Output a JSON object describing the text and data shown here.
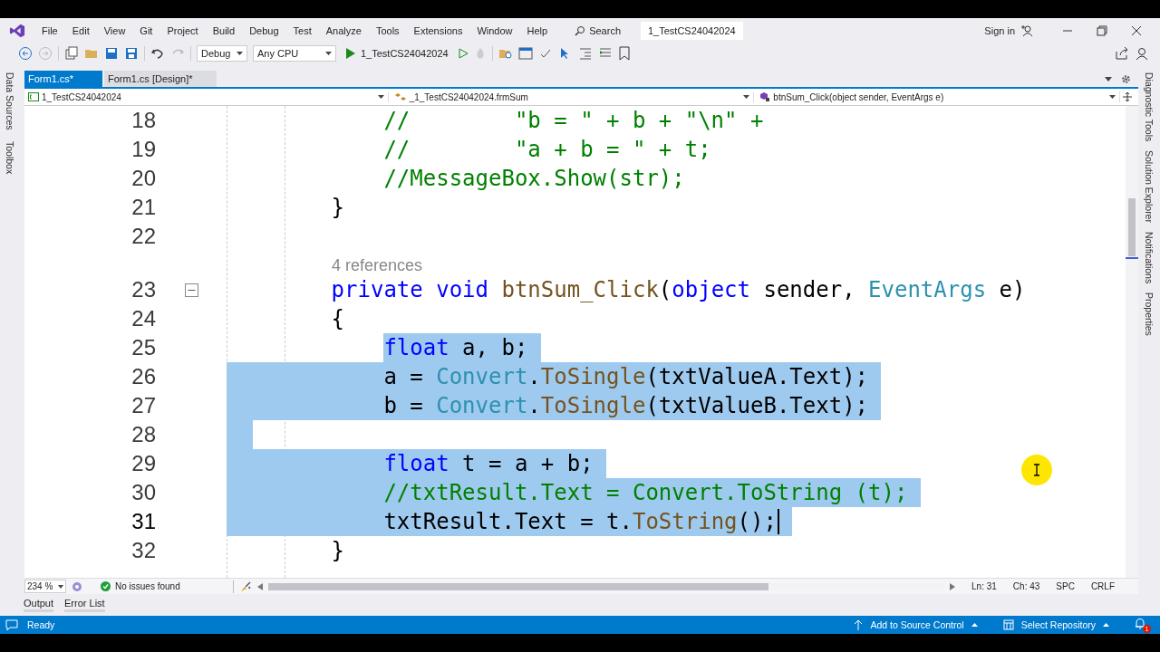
{
  "menu_bar": {
    "items": [
      "File",
      "Edit",
      "View",
      "Git",
      "Project",
      "Build",
      "Debug",
      "Test",
      "Analyze",
      "Tools",
      "Extensions",
      "Window",
      "Help"
    ],
    "search": "Search",
    "solution_name": "1_TestCS24042024",
    "sign_in": "Sign in"
  },
  "toolbar": {
    "configuration": "Debug",
    "platform": "Any CPU",
    "start_target": "1_TestCS24042024"
  },
  "left_panel_tabs": [
    "Data Sources",
    "Toolbox"
  ],
  "right_panel_tabs": [
    "Diagnostic Tools",
    "Solution Explorer",
    "Notifications",
    "Properties"
  ],
  "document_tabs": [
    {
      "label": "Form1.cs*",
      "selected": true
    },
    {
      "label": "Form1.cs [Design]*",
      "selected": false
    }
  ],
  "navigation_bar": {
    "project": "1_TestCS24042024",
    "class": "_1_TestCS24042024.frmSum",
    "member": "btnSum_Click(object sender, EventArgs e)"
  },
  "editor": {
    "lines": [
      {
        "kind": "code",
        "number": "18",
        "selected": false,
        "tokens": [
          {
            "kind": "comment",
            "text": "            //        \"b = \" + b + \"\\n\" +"
          }
        ]
      },
      {
        "kind": "code",
        "number": "19",
        "selected": false,
        "tokens": [
          {
            "kind": "comment",
            "text": "            //        \"a + b = \" + t;"
          }
        ]
      },
      {
        "kind": "code",
        "number": "20",
        "selected": false,
        "tokens": [
          {
            "kind": "comment",
            "text": "            //MessageBox.Show(str);"
          }
        ]
      },
      {
        "kind": "code",
        "number": "21",
        "selected": false,
        "tokens": [
          {
            "kind": "plain",
            "text": "        }"
          }
        ]
      },
      {
        "kind": "code",
        "number": "22",
        "selected": false
      },
      {
        "kind": "codelens",
        "text": "4 references"
      },
      {
        "kind": "code",
        "number": "23",
        "selected": false,
        "expanded": true,
        "tokens": [
          {
            "kind": "keyword",
            "text": "        private void "
          },
          {
            "kind": "method",
            "text": "btnSum_Click"
          },
          {
            "kind": "plain",
            "text": "("
          },
          {
            "kind": "keyword",
            "text": "object"
          },
          {
            "kind": "plain",
            "text": " sender, "
          },
          {
            "kind": "type",
            "text": "EventArgs"
          },
          {
            "kind": "plain",
            "text": " e)"
          }
        ]
      },
      {
        "kind": "code",
        "number": "24",
        "selected": false,
        "tokens": [
          {
            "kind": "plain",
            "text": "        {"
          }
        ]
      },
      {
        "kind": "code",
        "number": "25",
        "selected": true,
        "from_code": true,
        "tokens": [
          {
            "kind": "keyword",
            "text": "            float"
          },
          {
            "kind": "plain",
            "text": " a, b;"
          }
        ]
      },
      {
        "kind": "code",
        "number": "26",
        "selected": true,
        "tokens": [
          {
            "kind": "plain",
            "text": "            a = "
          },
          {
            "kind": "type",
            "text": "Convert"
          },
          {
            "kind": "plain",
            "text": "."
          },
          {
            "kind": "method",
            "text": "ToSingle"
          },
          {
            "kind": "plain",
            "text": "(txtValueA.Text);"
          }
        ]
      },
      {
        "kind": "code",
        "number": "27",
        "selected": true,
        "tokens": [
          {
            "kind": "plain",
            "text": "            b = "
          },
          {
            "kind": "type",
            "text": "Convert"
          },
          {
            "kind": "plain",
            "text": "."
          },
          {
            "kind": "method",
            "text": "ToSingle"
          },
          {
            "kind": "plain",
            "text": "(txtValueB.Text);"
          }
        ]
      },
      {
        "kind": "code",
        "number": "28",
        "selected": true
      },
      {
        "kind": "code",
        "number": "29",
        "selected": true,
        "tokens": [
          {
            "kind": "keyword",
            "text": "            float"
          },
          {
            "kind": "plain",
            "text": " t = a + b;"
          }
        ]
      },
      {
        "kind": "code",
        "number": "30",
        "selected": true,
        "tokens": [
          {
            "kind": "comment",
            "text": "            //txtResult.Text = Convert.ToString (t);"
          }
        ]
      },
      {
        "kind": "code",
        "number": "31",
        "selected": true,
        "caret": true,
        "tokens": [
          {
            "kind": "plain",
            "text": "            txtResult.Text = t."
          },
          {
            "kind": "method",
            "text": "ToString"
          },
          {
            "kind": "plain",
            "text": "();"
          }
        ]
      },
      {
        "kind": "code",
        "number": "32",
        "selected": false,
        "tokens": [
          {
            "kind": "plain",
            "text": "        }"
          }
        ]
      }
    ]
  },
  "editor_status": {
    "zoom": "234 %",
    "issues": "No issues found",
    "line": "Ln: 31",
    "column": "Ch: 43",
    "whitespace": "SPC",
    "line_ending": "CRLF"
  },
  "tool_tabs": [
    "Output",
    "Error List"
  ],
  "status_bar": {
    "state": "Ready",
    "source_control": "Add to Source Control",
    "repository": "Select Repository",
    "notifications": "1"
  }
}
